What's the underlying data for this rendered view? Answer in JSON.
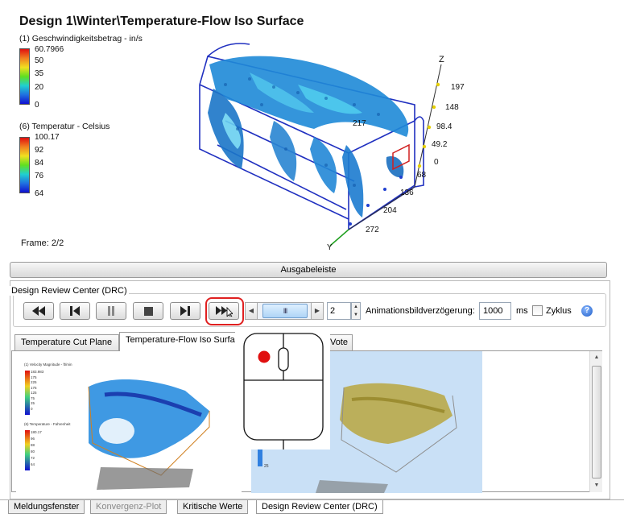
{
  "viewport": {
    "title": "Design 1\\Winter\\Temperature-Flow Iso Surface",
    "legend_velocity": {
      "title": "(1) Geschwindigkeitsbetrag - in/s",
      "values": [
        "60.7966",
        "50",
        "35",
        "20",
        "0"
      ]
    },
    "legend_temperature": {
      "title": "(6) Temperatur - Celsius",
      "values": [
        "100.17",
        "92",
        "84",
        "76",
        "64"
      ]
    },
    "frame": "Frame: 2/2",
    "axis_z_label": "Z",
    "axis_y_label": "Y",
    "z_ticks": [
      "197",
      "148",
      "98.4",
      "49.2",
      "0"
    ],
    "y_ticks": [
      "68",
      "136",
      "204",
      "272"
    ],
    "x_tick_label": "217"
  },
  "output_bar": {
    "label": "Ausgabeleiste"
  },
  "drc": {
    "group_label": "Design Review Center (DRC)",
    "buttons": [
      {
        "name": "skip-back",
        "icon": "skip-back-icon"
      },
      {
        "name": "step-back",
        "icon": "step-back-icon"
      },
      {
        "name": "pause",
        "icon": "pause-icon"
      },
      {
        "name": "stop",
        "icon": "stop-icon"
      },
      {
        "name": "step-forward",
        "icon": "step-forward-icon"
      },
      {
        "name": "fast-forward",
        "icon": "fast-forward-icon"
      }
    ],
    "slider_thumb": "III",
    "frame_step_value": "2",
    "delay_label": "Animationsbildverzögerung:",
    "delay_value": "1000",
    "delay_unit": "ms",
    "zyklus_label": "Zyklus",
    "zyklus_checked": false,
    "help": "?"
  },
  "tabs": [
    {
      "label": "Temperature Cut Plane",
      "active": false
    },
    {
      "label": "Temperature-Flow Iso Surface",
      "active": true
    },
    {
      "label": "Vote",
      "active": false
    }
  ],
  "thumbnail_left": {
    "legend_velocity_title": "(1) Velocity Magnitude - ft/min",
    "legend_velocity_values": [
      "183.983",
      "175",
      "225",
      "175",
      "125",
      "75",
      "25",
      "0"
    ],
    "legend_temperature_title": "(6) Temperature - Fahrenheit",
    "legend_temperature_values": [
      "180.17",
      "96",
      "88",
      "80",
      "72",
      "64"
    ]
  },
  "thumbnail_right": {
    "legend_values": [
      "25"
    ]
  },
  "bottom_tabs": [
    {
      "label": "Meldungsfenster",
      "state": "normal"
    },
    {
      "label": "Konvergenz-Plot",
      "state": "disabled"
    },
    {
      "label": "Kritische Werte",
      "state": "normal"
    },
    {
      "label": "Design Review Center (DRC)",
      "state": "active"
    }
  ],
  "colors": {
    "accent_red": "#e02020",
    "mouse_button_red": "#e01010",
    "thumb_right_bg": "#c9e0f6",
    "iso_blue": "#1c7fd6",
    "iso_gold": "#b8a640"
  }
}
